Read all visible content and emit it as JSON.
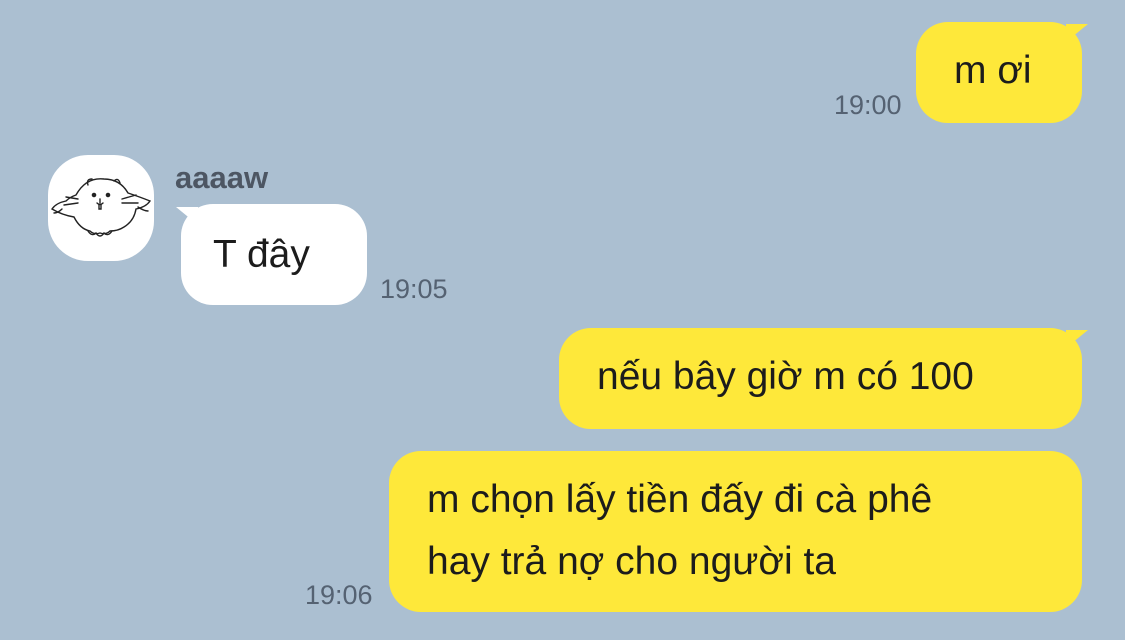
{
  "conversation": {
    "messages": [
      {
        "direction": "outgoing",
        "text": "m ơi",
        "time": "19:00"
      },
      {
        "direction": "incoming",
        "sender": "aaaaw",
        "text": "T đây",
        "time": "19:05"
      },
      {
        "direction": "outgoing",
        "text": "nếu bây giờ m có 100"
      },
      {
        "direction": "outgoing",
        "lines": [
          "m chọn lấy tiền đấy đi cà phê",
          "hay trả nợ cho người ta"
        ],
        "time": "19:06"
      }
    ]
  },
  "contact": {
    "name": "aaaaw",
    "avatar_icon": "hamster-sketch-icon"
  },
  "colors": {
    "background": "#abbfd1",
    "outgoing_bubble": "#fee83a",
    "incoming_bubble": "#ffffff",
    "timestamp": "#556272"
  }
}
